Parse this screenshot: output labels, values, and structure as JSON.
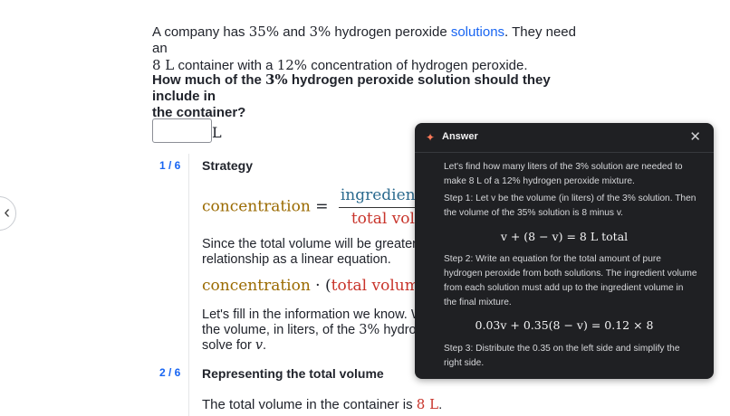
{
  "problem": {
    "text_before": "A company has ",
    "pct_a": "35%",
    "and": " and ",
    "pct_b": "3%",
    "text_mid": " hydrogen peroxide ",
    "link": "solutions",
    "text_after": ". They need an",
    "line2_vol": "8 L",
    "line2_mid": " container with a ",
    "line2_pct": "12%",
    "line2_end": " concentration of hydrogen peroxide."
  },
  "question": {
    "pre": "How much of the ",
    "pct": "3%",
    "post": " hydrogen peroxide solution should they include in",
    "line2": "the container?"
  },
  "answer_input": {
    "value": "",
    "unit": "L"
  },
  "steps": [
    {
      "num": "1 / 6",
      "title": "Strategy",
      "eq_lhs": "concentration",
      "eq_equals": "=",
      "eq_num": "ingredient volu",
      "eq_den": "total volume",
      "text1_a": "Since the total volume will be greater t",
      "text1_b": "relationship as a linear equation.",
      "eq2_a": "concentration",
      "eq2_dot": " · (",
      "eq2_b": "total volume",
      "eq2_end": ") =",
      "text2_a": "Let's fill in the information we know. W",
      "text2_b_pre": "the volume, in liters, of the ",
      "text2_b_pct": "3%",
      "text2_b_post": " hydrog",
      "text2_c_pre": "solve for ",
      "text2_c_var": "v",
      "text2_c_end": "."
    },
    {
      "num": "2 / 6",
      "title": "Representing the total volume",
      "line_pre": "The total volume in the container is ",
      "line_val": "8 L",
      "line_end": "."
    }
  ],
  "answer_panel": {
    "title": "Answer",
    "intro": "Let's find how many liters of the 3% solution are needed to make 8 L of a 12% hydrogen peroxide mixture.",
    "step1": "Step 1: Let v be the volume (in liters) of the 3% solution. Then the volume of the 35% solution is 8 minus v.",
    "eq1": "v + (8 − v) = 8 L total",
    "step2": "Step 2: Write an equation for the total amount of pure hydrogen peroxide from both solutions. The ingredient volume from each solution must add up to the ingredient volume in the final mixture.",
    "eq2": "0.03v + 0.35(8 − v) = 0.12 × 8",
    "step3": "Step 3: Distribute the 0.35 on the left side and simplify the right side."
  },
  "icons": {
    "back": "chevron-left-icon",
    "sparkle": "sparkle-icon",
    "close": "close-icon"
  },
  "colors": {
    "link_blue": "#1865f2",
    "teal": "#2c6b8f",
    "red": "#c8332a",
    "gold": "#9a6a00",
    "panel_bg": "#1f2023",
    "spark": "#ff7a59"
  }
}
